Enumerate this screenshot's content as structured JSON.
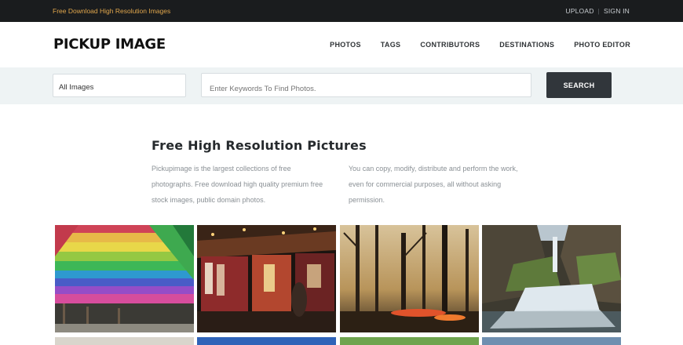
{
  "topbar": {
    "tagline": "Free Download High Resolution Images",
    "upload": "UPLOAD",
    "separator": "|",
    "signin": "SIGN IN"
  },
  "header": {
    "logo": "PICKUP IMAGE",
    "nav": [
      "PHOTOS",
      "TAGS",
      "CONTRIBUTORS",
      "DESTINATIONS",
      "PHOTO EDITOR"
    ]
  },
  "search": {
    "category": "All Images",
    "placeholder": "Enter Keywords To Find Photos.",
    "button": "SEARCH"
  },
  "intro": {
    "title": "Free High Resolution Pictures",
    "left_text": "Pickupimage is the largest collections of free photographs. Free download high quality premium free stock images, public domain photos.",
    "right_text": "You can copy, modify, distribute and perform the work, even for commercial purposes, all without asking permission."
  },
  "colors": {
    "topbar_bg": "#1a1c1e",
    "tagline": "#e0a64c",
    "search_band": "#eef3f4",
    "button_bg": "#31363b"
  }
}
